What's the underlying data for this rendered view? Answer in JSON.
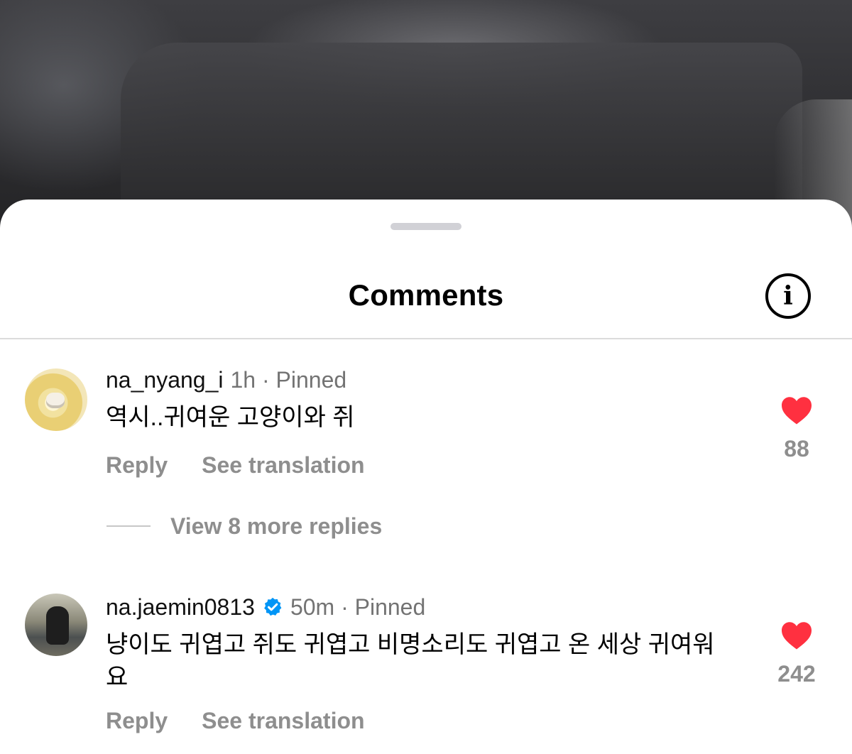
{
  "sheet": {
    "title": "Comments",
    "info_icon": "info-icon"
  },
  "comments": [
    {
      "username": "na_nyang_i",
      "verified": false,
      "meta": "1h · Pinned",
      "text": "역시..귀여운 고양이와 쥐",
      "reply_label": "Reply",
      "translate_label": "See translation",
      "likes": "88",
      "liked": true,
      "more_replies": "View 8 more replies"
    },
    {
      "username": "na.jaemin0813",
      "verified": true,
      "meta": "50m · Pinned",
      "text": "냥이도 귀엽고 쥐도 귀엽고 비명소리도 귀엽고 온 세상 귀여워요",
      "reply_label": "Reply",
      "translate_label": "See translation",
      "likes": "242",
      "liked": true
    }
  ],
  "colors": {
    "like_red": "#ff3040",
    "verified_blue": "#0095f6",
    "secondary_text": "#8e8e8e"
  }
}
